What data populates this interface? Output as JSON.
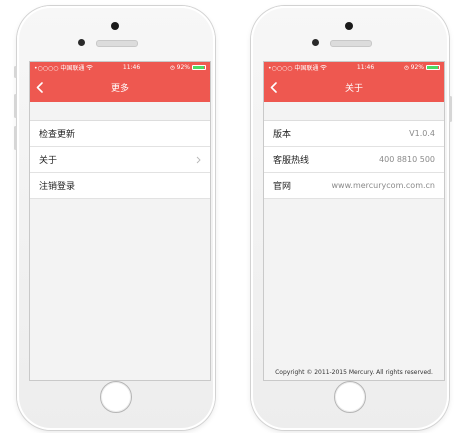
{
  "status_bar": {
    "carrier": "•○○○○ 中国联通",
    "time": "11:46",
    "battery": "92%",
    "battery_level": 0.92,
    "signal_icon": "signal-dots-icon",
    "wifi_icon": "wifi-icon",
    "alarm_icon": "alarm-icon"
  },
  "colors": {
    "nav_accent": "#ee5850",
    "battery_green": "#4cd964"
  },
  "more_screen": {
    "title": "更多",
    "back_icon": "chevron-left-icon",
    "items": [
      {
        "label": "检查更新"
      },
      {
        "label": "关于",
        "has_chevron": true
      },
      {
        "label": "注销登录"
      }
    ]
  },
  "about_screen": {
    "title": "关于",
    "back_icon": "chevron-left-icon",
    "rows": [
      {
        "label": "版本",
        "value": "V1.0.4"
      },
      {
        "label": "客服热线",
        "value": "400 8810 500"
      },
      {
        "label": "官网",
        "value": "www.mercurycom.com.cn"
      }
    ],
    "footer": "Copyright © 2011-2015 Mercury. All rights reserved."
  }
}
